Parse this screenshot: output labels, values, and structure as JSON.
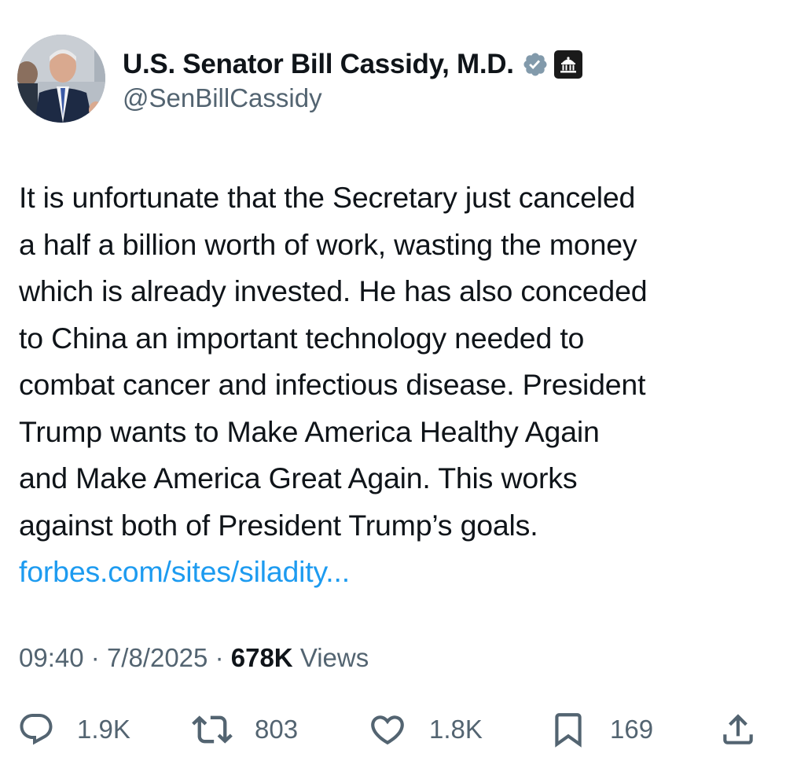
{
  "author": {
    "display_name": "U.S. Senator Bill Cassidy, M.D.",
    "handle": "@SenBillCassidy",
    "avatar_icon": "profile-photo",
    "verified_icon": "verified-badge-icon",
    "affiliation_icon": "government-building-icon",
    "verified_color": "#829aab"
  },
  "tweet": {
    "lines": [
      "It is unfortunate that the Secretary just canceled",
      "a half a billion worth of work, wasting the money",
      "which is already invested. He has also conceded",
      "to China an important technology needed to",
      "combat cancer and infectious disease. President",
      "Trump wants to Make America Healthy Again",
      "and Make America Great Again. This works",
      "against both of President Trump’s goals."
    ],
    "link_text": "forbes.com/sites/siladity...",
    "link_color": "#1d9bf0"
  },
  "meta": {
    "time": "09:40",
    "separator": "·",
    "date": "7/8/2025",
    "views_count": "678K",
    "views_label": "Views"
  },
  "actions": {
    "reply": {
      "icon": "reply-icon",
      "count": "1.9K"
    },
    "repost": {
      "icon": "repost-icon",
      "count": "803"
    },
    "like": {
      "icon": "heart-icon",
      "count": "1.8K"
    },
    "bookmark": {
      "icon": "bookmark-icon",
      "count": "169"
    },
    "share": {
      "icon": "share-icon"
    },
    "icon_color": "#536471"
  }
}
